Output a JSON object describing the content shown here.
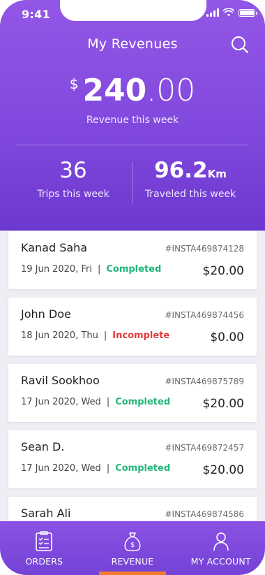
{
  "status_bar": {
    "time": "9:41"
  },
  "header": {
    "title": "My Revenues",
    "revenue": {
      "currency": "$",
      "whole": "240",
      "fraction": ".00",
      "label": "Revenue this week"
    },
    "stats": [
      {
        "value": "36",
        "unit": "",
        "label": "Trips this week"
      },
      {
        "value": "96.2",
        "unit": "Km",
        "label": "Traveled this week"
      }
    ]
  },
  "trips": [
    {
      "name": "Kanad Saha",
      "id": "#INSTA469874128",
      "date": "19 Jun 2020, Fri",
      "status": "Completed",
      "status_type": "completed",
      "amount": "$20.00"
    },
    {
      "name": "John Doe",
      "id": "#INSTA469874456",
      "date": "18 Jun 2020, Thu",
      "status": "Incomplete",
      "status_type": "incomplete",
      "amount": "$0.00"
    },
    {
      "name": "Ravil Sookhoo",
      "id": "#INSTA469875789",
      "date": "17 Jun 2020, Wed",
      "status": "Completed",
      "status_type": "completed",
      "amount": "$20.00"
    },
    {
      "name": "Sean D.",
      "id": "#INSTA469872457",
      "date": "17 Jun 2020, Wed",
      "status": "Completed",
      "status_type": "completed",
      "amount": "$20.00"
    },
    {
      "name": "Sarah Ali",
      "id": "#INSTA469874586",
      "date": "",
      "status": "",
      "status_type": "completed",
      "amount": ""
    }
  ],
  "nav": {
    "items": [
      {
        "label": "ORDERS",
        "icon": "orders-icon"
      },
      {
        "label": "REVENUE",
        "icon": "revenue-bag-icon",
        "active": true
      },
      {
        "label": "MY ACCOUNT",
        "icon": "account-icon"
      }
    ]
  },
  "colors": {
    "accent": "#8a52e3",
    "completed": "#23b57a",
    "incomplete": "#e33b3b",
    "active_indicator": "#f57a2f"
  }
}
